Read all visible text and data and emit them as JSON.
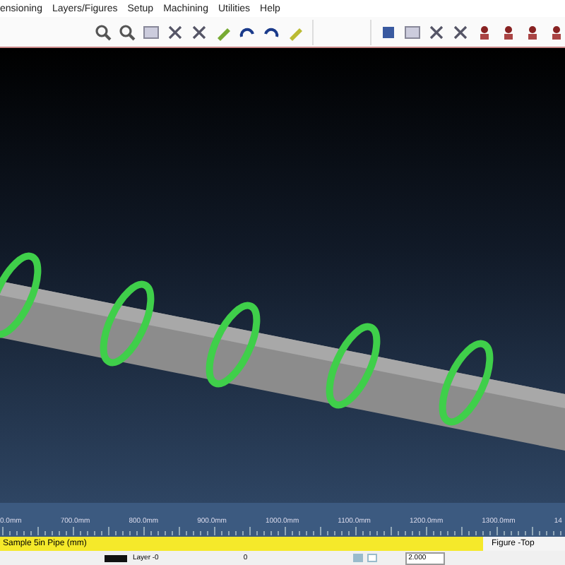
{
  "menu": [
    "ensioning",
    "Layers/Figures",
    "Setup",
    "Machining",
    "Utilities",
    "Help"
  ],
  "toolbar_left": [
    {
      "kind": "zoom"
    },
    {
      "kind": "zoom"
    },
    {
      "kind": "window"
    },
    {
      "kind": "fit"
    },
    {
      "kind": "fit"
    },
    {
      "kind": "pen"
    },
    {
      "kind": "undo"
    },
    {
      "kind": "redo"
    },
    {
      "kind": "eraser"
    }
  ],
  "toolbar_right": [
    {
      "kind": "cube"
    },
    {
      "kind": "window"
    },
    {
      "kind": "fit"
    },
    {
      "kind": "fit"
    },
    {
      "kind": "view"
    },
    {
      "kind": "view"
    },
    {
      "kind": "view"
    },
    {
      "kind": "view"
    }
  ],
  "ruler": [
    "0.0mm",
    "700.0mm",
    "800.0mm",
    "900.0mm",
    "1000.0mm",
    "1100.0mm",
    "1200.0mm",
    "1300.0mm",
    "14"
  ],
  "status_bar": {
    "file": "Sample 5in Pipe (mm)",
    "view": "Figure -Top"
  },
  "bottom_bar": {
    "layer": "Layer -0",
    "angle": "0",
    "options": [
      {
        "checked": true
      },
      {
        "checked": false
      }
    ],
    "step": "2.000"
  }
}
